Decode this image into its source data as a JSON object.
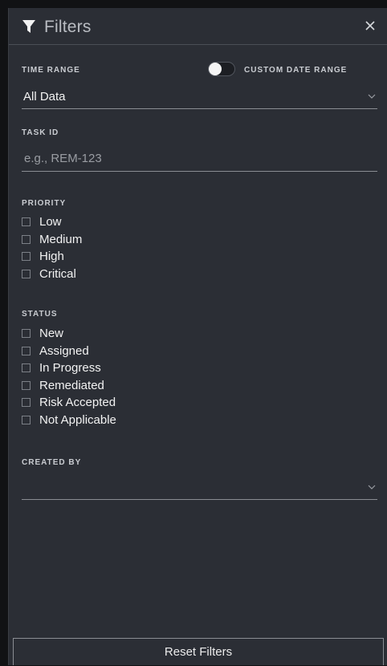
{
  "header": {
    "title": "Filters",
    "close_glyph": "✕"
  },
  "time_range": {
    "label": "TIME RANGE",
    "custom_toggle_label": "CUSTOM DATE RANGE",
    "custom_toggle_on": false,
    "selected": "All Data"
  },
  "task_id": {
    "label": "TASK ID",
    "value": "",
    "placeholder": "e.g., REM-123"
  },
  "priority": {
    "label": "PRIORITY",
    "options": [
      {
        "label": "Low",
        "checked": false
      },
      {
        "label": "Medium",
        "checked": false
      },
      {
        "label": "High",
        "checked": false
      },
      {
        "label": "Critical",
        "checked": false
      }
    ]
  },
  "status": {
    "label": "STATUS",
    "options": [
      {
        "label": "New",
        "checked": false
      },
      {
        "label": "Assigned",
        "checked": false
      },
      {
        "label": "In Progress",
        "checked": false
      },
      {
        "label": "Remediated",
        "checked": false
      },
      {
        "label": "Risk Accepted",
        "checked": false
      },
      {
        "label": "Not Applicable",
        "checked": false
      }
    ]
  },
  "created_by": {
    "label": "CREATED BY",
    "selected": ""
  },
  "footer": {
    "reset_label": "Reset Filters"
  },
  "icons": {
    "header": "funnel-icon",
    "close": "close-icon",
    "dropdown": "chevron-down-icon"
  },
  "colors": {
    "panel_background": "#2b2e35",
    "page_background": "#111214",
    "text": "#f2f2f2",
    "muted_title": "#b9bcc2",
    "underline": "#8a8d93"
  }
}
